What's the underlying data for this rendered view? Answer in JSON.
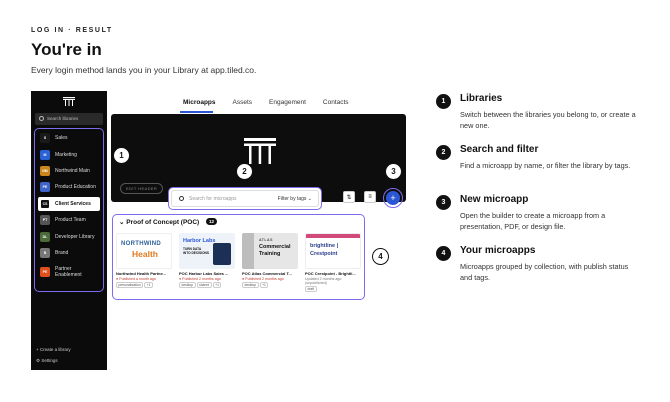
{
  "header": {
    "eyebrow": "LOG IN · RESULT",
    "title": "You're in",
    "subtitle": "Every login method lands you in your Library at app.tiled.co."
  },
  "sidebar": {
    "search_placeholder": "Search libraries",
    "items": [
      {
        "badge": "S",
        "label": "Sales",
        "color": "#1a1a1a"
      },
      {
        "badge": "M",
        "label": "Marketing",
        "color": "#2a62d6"
      },
      {
        "badge": "NM",
        "label": "Northwind Main",
        "color": "#c8861d"
      },
      {
        "badge": "PE",
        "label": "Product Education",
        "color": "#3f63c9"
      },
      {
        "badge": "CS",
        "label": "Client Services",
        "color": "#111111"
      },
      {
        "badge": "PT",
        "label": "Product Team",
        "color": "#555555"
      },
      {
        "badge": "DL",
        "label": "Developer Library",
        "color": "#4a6a3a"
      },
      {
        "badge": "B",
        "label": "Brand",
        "color": "#777777"
      },
      {
        "badge": "PE",
        "label": "Partner Enablement",
        "color": "#e0501d"
      }
    ],
    "create_label": "+ Create a library",
    "settings_label": "Settings"
  },
  "tabs": [
    "Microapps",
    "Assets",
    "Engagement",
    "Contacts"
  ],
  "hero": {
    "edit_label": "EDIT HEADER"
  },
  "search": {
    "placeholder": "Search for microapps",
    "filter_label": "Filter by tags ⌄"
  },
  "collection": {
    "title": "Proof of Concept (POC)",
    "count": "12",
    "cards": [
      {
        "name": "Northwind Health Partne...",
        "status": "● Published a month ago",
        "tags": [
          "personalization",
          "+1"
        ],
        "thumb_line1": "NORTHWIND",
        "thumb_line2": "Health"
      },
      {
        "name": "POC Harbor Labs Sales ...",
        "status": "● Published 2 months ago",
        "tags": [
          "desktop",
          "shared",
          "+1"
        ],
        "thumb_line1": "Harbor Labs",
        "thumb_line2": "TURN DATA INTO DECISIONS"
      },
      {
        "name": "POC Atlas Commercial T...",
        "status": "● Published 2 months ago",
        "tags": [
          "desktop",
          "+1"
        ],
        "thumb_line1": "ATLAS",
        "thumb_line2": "Commercial Training"
      },
      {
        "name": "POC Crestpoint - Brightli...",
        "status": "Updated 2 months ago (unpublished)",
        "tags": [
          "draft"
        ],
        "thumb_line1": "brightline |",
        "thumb_line2": "Crestpoint"
      }
    ]
  },
  "callouts": [
    "1",
    "2",
    "3",
    "4"
  ],
  "steps": [
    {
      "num": "1",
      "title": "Libraries",
      "desc": "Switch between the libraries you belong to, or create a new one."
    },
    {
      "num": "2",
      "title": "Search and filter",
      "desc": "Find a microapp by name, or filter the library by tags."
    },
    {
      "num": "3",
      "title": "New microapp",
      "desc": "Open the builder to create a microapp from a presentation, PDF, or design file."
    },
    {
      "num": "4",
      "title": "Your microapps",
      "desc": "Microapps grouped by collection, with publish status and tags."
    }
  ],
  "colors": {
    "accent": "#7c6cf0",
    "primary": "#2b57d6",
    "dark": "#0b0b0b"
  }
}
